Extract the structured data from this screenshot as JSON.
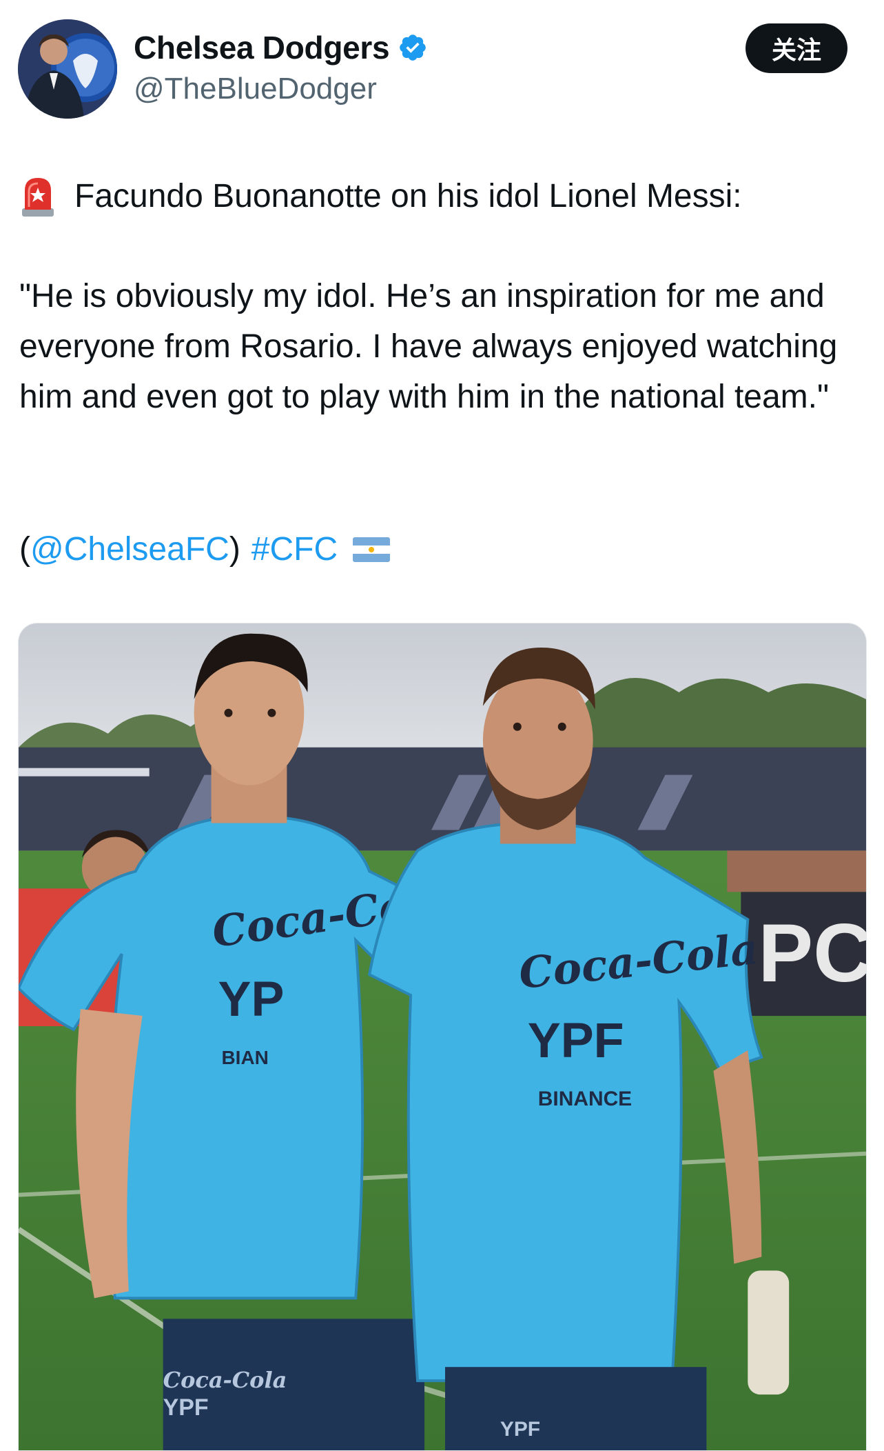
{
  "author": {
    "display_name": "Chelsea Dodgers",
    "handle": "@TheBlueDodger",
    "verified": true,
    "avatar_icon": "profile-avatar"
  },
  "follow_label": "关注",
  "tweet": {
    "headline": "Facundo Buonanotte on his idol Lionel Messi:",
    "headline_icon": "siren-emoji",
    "quote": "\"He is obviously my idol. He’s an inspiration for me and everyone from Rosario. I have always enjoyed watching him and even got to play with him in the national team.\"",
    "mention": "@ChelseaFC",
    "paren_open": "(",
    "paren_close": ")",
    "hashtag": "#CFC",
    "flag_icon": "argentina-flag-emoji"
  },
  "media": {
    "description_icon": "photo",
    "shirt_sponsor_1": "Coca-Cola",
    "shirt_sponsor_2": "YPF",
    "shirt_sponsor_3": "BINANCE",
    "shirt_sponsor_3_partial": "BIAN",
    "shirt_sponsor_2_partial": "YP",
    "board_text": "PC"
  },
  "colors": {
    "link": "#1d9bf0",
    "text": "#0f1419",
    "secondary": "#536471",
    "button_bg": "#0f1419",
    "verified": "#1d9bf0",
    "jersey": "#3fb4e4"
  }
}
